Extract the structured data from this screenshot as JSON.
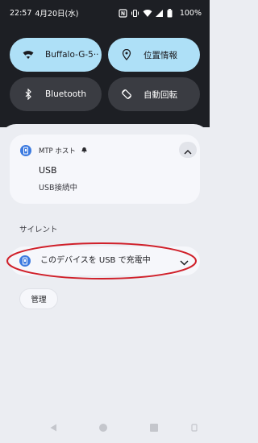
{
  "status_bar": {
    "time": "22:57",
    "date": "4月20日(水)",
    "battery_percent": "100%"
  },
  "quick_tiles": [
    {
      "label": "Buffalo-G-5··",
      "icon": "wifi-icon",
      "active": true
    },
    {
      "label": "位置情報",
      "icon": "location-icon",
      "active": true
    },
    {
      "label": "Bluetooth",
      "icon": "bluetooth-icon",
      "active": false
    },
    {
      "label": "自動回転",
      "icon": "auto-rotate-icon",
      "active": false
    }
  ],
  "notification": {
    "app_name": "MTP ホスト",
    "title": "USB",
    "body": "USB接続中"
  },
  "silent_section": {
    "label": "サイレント",
    "item_text": "このデバイスを USB で充電中"
  },
  "manage_button": "管理",
  "colors": {
    "tile_active": "#aee0f7",
    "tile_inactive": "#3a3c42",
    "app_icon": "#3d7be0",
    "highlight_ellipse": "#d0202a"
  }
}
